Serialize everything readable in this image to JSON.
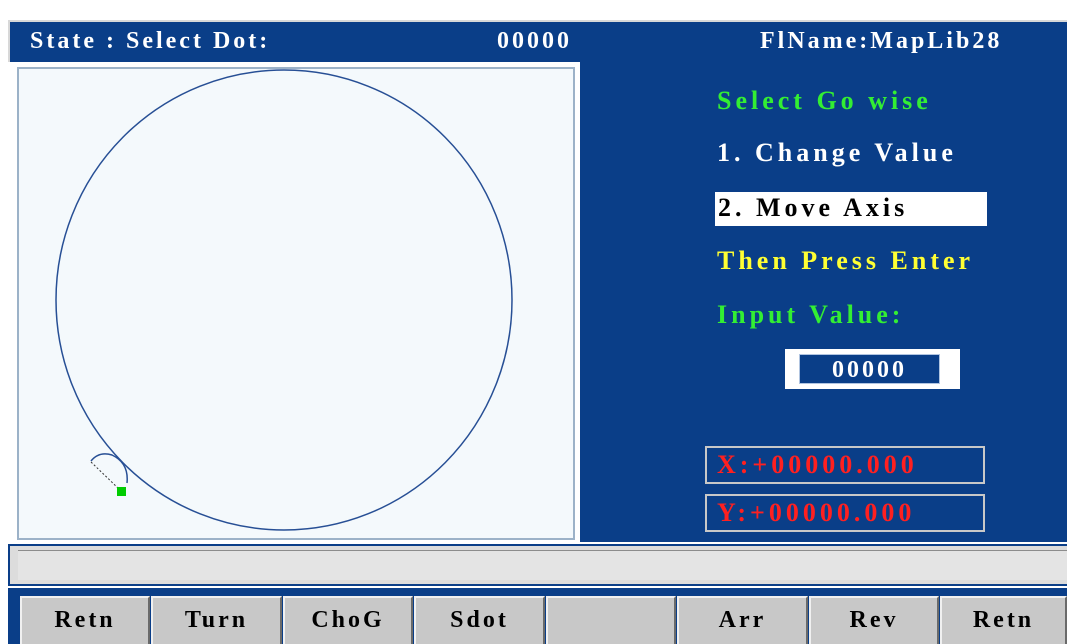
{
  "titlebar": {
    "state": "State : Select Dot:",
    "dot_number": "00000",
    "filename": "FlName:MapLib28"
  },
  "right_panel": {
    "select_go_wise": "Select Go wise",
    "option1": "1. Change Value",
    "option2": "2. Move Axis",
    "then_press": "Then Press Enter",
    "input_label": "Input Value:",
    "input_value": "00000",
    "x_coord": "X:+00000.000",
    "y_coord": "Y:+00000.000"
  },
  "function_keys": [
    {
      "label": "Retn"
    },
    {
      "label": "Turn"
    },
    {
      "label": "ChoG"
    },
    {
      "label": "Sdot"
    },
    {
      "label": ""
    },
    {
      "label": "Arr"
    },
    {
      "label": "Rev"
    },
    {
      "label": "Retn"
    }
  ],
  "colors": {
    "panel_blue": "#0a3e88",
    "highlight_green": "#33ee33",
    "prompt_yellow": "#ffff33",
    "coord_red": "#ff2020",
    "marker_green": "#00cc00"
  },
  "icons": {
    "path": "circle-path",
    "start_marker": "green-square-marker"
  }
}
